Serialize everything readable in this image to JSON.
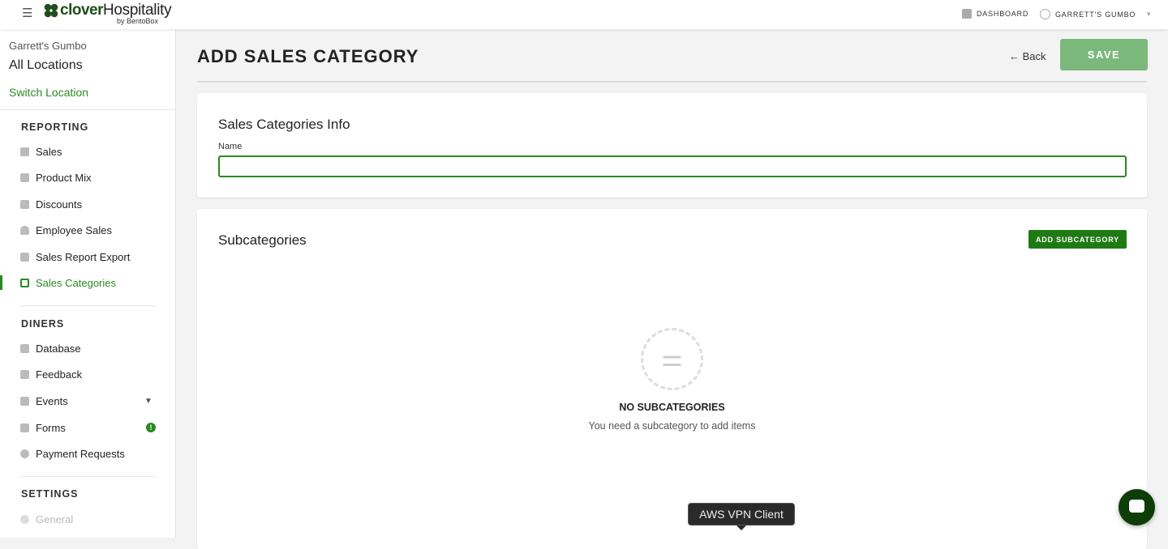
{
  "topbar": {
    "brand": "clover",
    "brand_suffix": "Hospitality",
    "byline": "by BentoBox",
    "dashboard": "DASHBOARD",
    "account": "GARRETT'S GUMBO"
  },
  "sidebar": {
    "restaurant": "Garrett's Gumbo",
    "location": "All Locations",
    "switch": "Switch Location",
    "sections": [
      {
        "title": "REPORTING"
      },
      {
        "title": "DINERS"
      },
      {
        "title": "SETTINGS"
      }
    ],
    "reporting": [
      "Sales",
      "Product Mix",
      "Discounts",
      "Employee Sales",
      "Sales Report Export",
      "Sales Categories"
    ],
    "diners": [
      "Database",
      "Feedback",
      "Events",
      "Forms",
      "Payment Requests"
    ],
    "settings": [
      "General"
    ],
    "forms_badge": "!"
  },
  "page": {
    "title": "ADD SALES CATEGORY",
    "back": "← Back",
    "save": "SAVE"
  },
  "info": {
    "title": "Sales Categories Info",
    "name_label": "Name",
    "name_value": ""
  },
  "subcategories": {
    "title": "Subcategories",
    "add": "ADD SUBCATEGORY",
    "empty_title": "NO SUBCATEGORIES",
    "empty_sub": "You need a subcategory to add items"
  },
  "tooltip": "AWS VPN Client",
  "colors": {
    "accent": "#2a8a22",
    "save": "#7bb87b",
    "brand": "#1f4d1b"
  }
}
